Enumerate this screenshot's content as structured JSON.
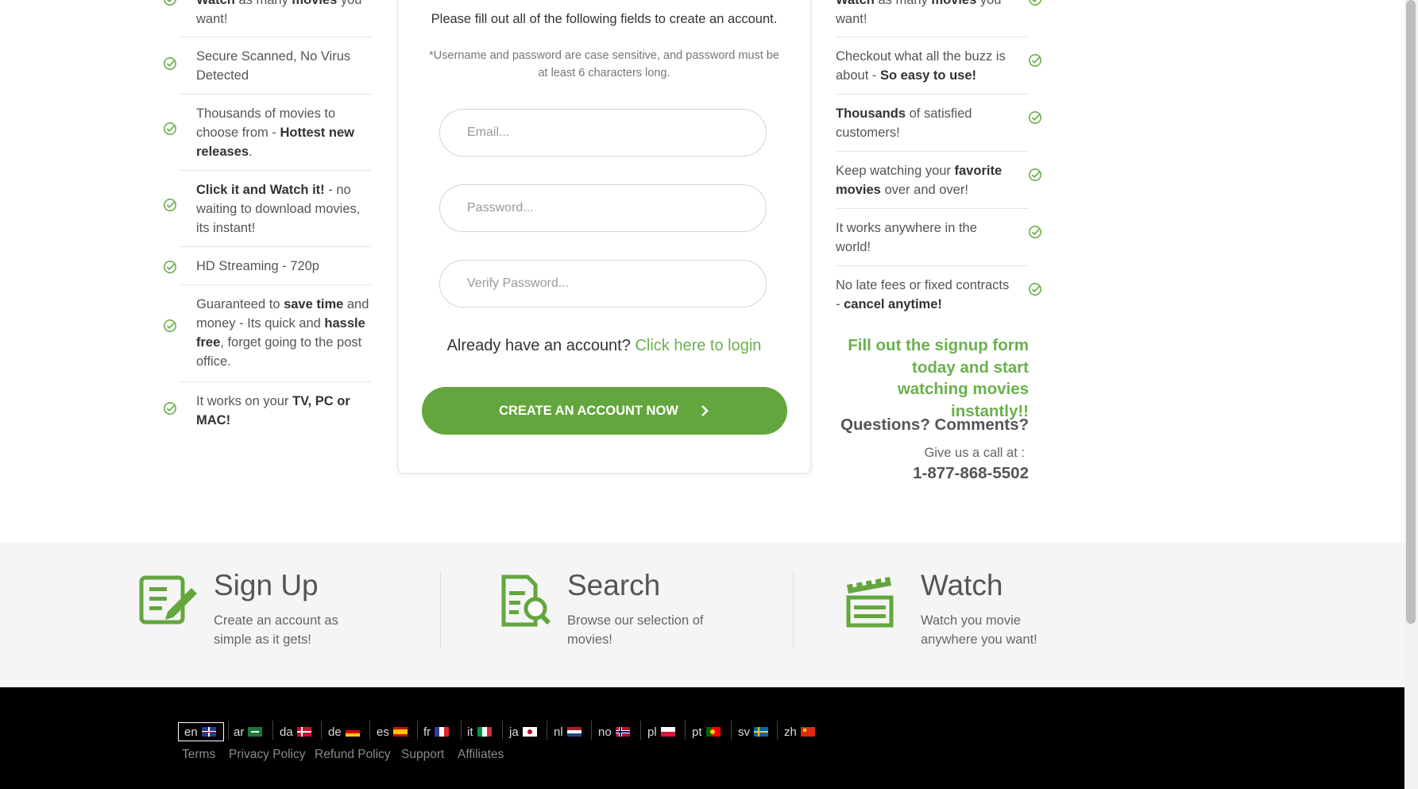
{
  "left_features": [
    {
      "segments": [
        {
          "t": "Watch",
          "b": true
        },
        {
          "t": " as many ",
          "b": false
        },
        {
          "t": "movies",
          "b": true
        },
        {
          "t": " you want!",
          "b": false
        }
      ]
    },
    {
      "segments": [
        {
          "t": "Secure Scanned, No Virus Detected",
          "b": false
        }
      ]
    },
    {
      "segments": [
        {
          "t": "Thousands of movies to choose from - ",
          "b": false
        },
        {
          "t": "Hottest new releases",
          "b": true
        },
        {
          "t": ".",
          "b": false
        }
      ]
    },
    {
      "segments": [
        {
          "t": "Click it and Watch it!",
          "b": true
        },
        {
          "t": " - no waiting to download movies, its instant!",
          "b": false
        }
      ]
    },
    {
      "segments": [
        {
          "t": "HD Streaming - 720p",
          "b": false
        }
      ]
    },
    {
      "segments": [
        {
          "t": "Guaranteed to ",
          "b": false
        },
        {
          "t": "save time",
          "b": true
        },
        {
          "t": " and money - Its quick and ",
          "b": false
        },
        {
          "t": "hassle free",
          "b": true
        },
        {
          "t": ", forget going to the post office.",
          "b": false
        }
      ]
    },
    {
      "segments": [
        {
          "t": "It works on your ",
          "b": false
        },
        {
          "t": "TV, PC or MAC!",
          "b": true
        }
      ]
    }
  ],
  "right_features": [
    {
      "segments": [
        {
          "t": "Watch",
          "b": true
        },
        {
          "t": " as many ",
          "b": false
        },
        {
          "t": "movies",
          "b": true
        },
        {
          "t": " you want!",
          "b": false
        }
      ]
    },
    {
      "segments": [
        {
          "t": "Checkout what all the buzz is about - ",
          "b": false
        },
        {
          "t": "So easy to use!",
          "b": true
        }
      ]
    },
    {
      "segments": [
        {
          "t": "Thousands",
          "b": true
        },
        {
          "t": " of satisfied customers!",
          "b": false
        }
      ]
    },
    {
      "segments": [
        {
          "t": "Keep watching your ",
          "b": false
        },
        {
          "t": "favorite movies",
          "b": true
        },
        {
          "t": " over and over!",
          "b": false
        }
      ]
    },
    {
      "segments": [
        {
          "t": "It works anywhere in the world!",
          "b": false
        }
      ]
    },
    {
      "segments": [
        {
          "t": "No late fees or fixed contracts - ",
          "b": false
        },
        {
          "t": "cancel anytime!",
          "b": true
        }
      ]
    }
  ],
  "form": {
    "intro": "Please fill out all of the following fields to create an account.",
    "note": "*Username and password are case sensitive, and password must be at least 6 characters long.",
    "email_placeholder": "Email...",
    "password_placeholder": "Password...",
    "verify_placeholder": "Verify Password...",
    "login_prompt": "Already have an account?",
    "login_link": "Click here to login",
    "cta_label": "CREATE AN ACCOUNT NOW"
  },
  "cta_side": {
    "signup_text": "Fill out the signup form today and start watching movies instantly!!",
    "questions": "Questions? Comments?",
    "call_label": "Give us a call at :",
    "phone": "1-877-868-5502"
  },
  "steps": [
    {
      "icon": "signup-form-icon",
      "title": "Sign Up",
      "desc": "Create an account as simple as it gets!"
    },
    {
      "icon": "search-document-icon",
      "title": "Search",
      "desc": "Browse our selection of movies!"
    },
    {
      "icon": "clapperboard-icon",
      "title": "Watch",
      "desc": "Watch you movie anywhere you want!"
    }
  ],
  "languages": [
    "en",
    "ar",
    "da",
    "de",
    "es",
    "fr",
    "it",
    "ja",
    "nl",
    "no",
    "pl",
    "pt",
    "sv",
    "zh"
  ],
  "footer_links": [
    "Terms",
    "Privacy Policy",
    "Refund Policy",
    "Support",
    "Affiliates"
  ],
  "colors": {
    "accent": "#64a63e",
    "link": "#6ab04c",
    "footer_bg": "#000000",
    "band_bg": "#f5f5f5"
  }
}
